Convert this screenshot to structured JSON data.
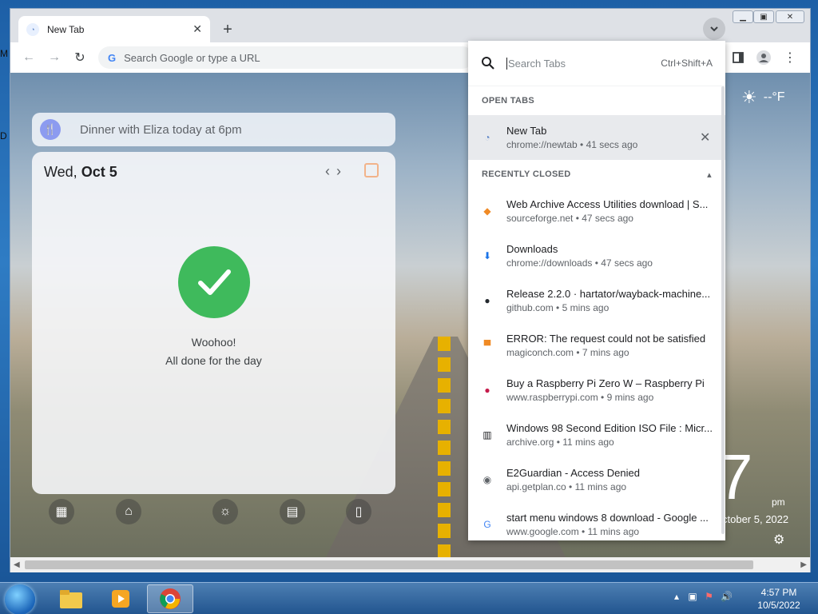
{
  "desktop": {
    "fragment_top": "M",
    "fragment_mid": "D"
  },
  "tab": {
    "title": "New Tab"
  },
  "omnibox": {
    "placeholder": "Search Google or type a URL"
  },
  "note": {
    "text": "Dinner with Eliza today at 6pm"
  },
  "tasks": {
    "weekday": "Wed,",
    "day": "Oct 5",
    "woohoo": "Woohoo!",
    "done": "All done for the day"
  },
  "weather": {
    "temp": "--°F"
  },
  "clock": {
    "digit": "7",
    "ampm": "pm",
    "date": "ctober 5, 2022"
  },
  "tab_search": {
    "placeholder": "Search Tabs",
    "shortcut": "Ctrl+Shift+A",
    "open_label": "OPEN TABS",
    "closed_label": "RECENTLY CLOSED",
    "open_tabs": [
      {
        "title": "New Tab",
        "sub": "chrome://newtab • 41 secs ago",
        "icon": "newtab-icon"
      }
    ],
    "recently_closed": [
      {
        "title": "Web Archive Access Utilities download | S...",
        "sub": "sourceforge.net • 47 secs ago",
        "icon": "sourceforge-icon",
        "glyph": "◆",
        "color": "#f08a24"
      },
      {
        "title": "Downloads",
        "sub": "chrome://downloads • 47 secs ago",
        "icon": "download-icon",
        "glyph": "⬇",
        "color": "#1a73e8"
      },
      {
        "title": "Release 2.2.0 · hartator/wayback-machine...",
        "sub": "github.com • 5 mins ago",
        "icon": "github-icon",
        "glyph": "●",
        "color": "#24292e"
      },
      {
        "title": "ERROR: The request could not be satisfied",
        "sub": "magiconch.com • 7 mins ago",
        "icon": "invader-icon",
        "glyph": "▀",
        "color": "#f08a24"
      },
      {
        "title": "Buy a Raspberry Pi Zero W – Raspberry Pi",
        "sub": "www.raspberrypi.com • 9 mins ago",
        "icon": "raspberry-icon",
        "glyph": "●",
        "color": "#c51a4a"
      },
      {
        "title": "Windows 98 Second Edition ISO File : Micr...",
        "sub": "archive.org • 11 mins ago",
        "icon": "archive-icon",
        "glyph": "▥",
        "color": "#202124"
      },
      {
        "title": "E2Guardian - Access Denied",
        "sub": "api.getplan.co • 11 mins ago",
        "icon": "globe-icon",
        "glyph": "◉",
        "color": "#5f6368"
      },
      {
        "title": "start menu windows 8 download - Google ...",
        "sub": "www.google.com • 11 mins ago",
        "icon": "google-icon",
        "glyph": "G",
        "color": "#4285f4"
      }
    ]
  },
  "taskbar": {
    "time": "4:57 PM",
    "date": "10/5/2022"
  }
}
